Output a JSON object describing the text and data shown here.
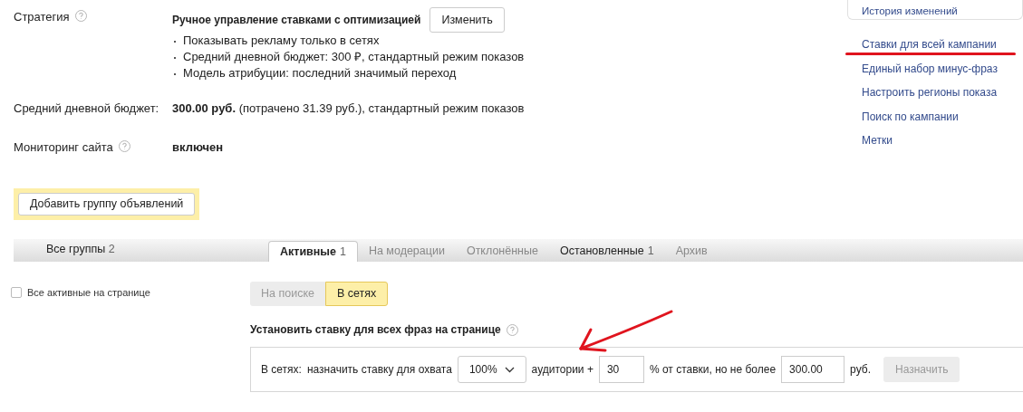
{
  "strategy": {
    "label": "Стратегия",
    "title": "Ручное управление ставками с оптимизацией",
    "change_button": "Изменить",
    "details": [
      "Показывать рекламу только в сетях",
      "Средний дневной бюджет: 300 ₽, стандартный режим показов",
      "Модель атрибуции: последний значимый переход"
    ]
  },
  "budget": {
    "label": "Средний дневной бюджет:",
    "value": "**300.00 руб.** (потрачено 31.39 руб.), стандартный режим показов"
  },
  "monitoring": {
    "label": "Мониторинг сайта",
    "value": "включен"
  },
  "side_card": {
    "link": "История изменений"
  },
  "side_links": [
    {
      "label": "Ставки для всей кампании",
      "underlined": true
    },
    {
      "label": "Единый набор минус-фраз",
      "underlined": false
    },
    {
      "label": "Настроить регионы показа",
      "underlined": false
    },
    {
      "label": "Поиск по кампании",
      "underlined": false
    },
    {
      "label": "Метки",
      "underlined": false
    }
  ],
  "add_group_button": "Добавить группу объявлений",
  "all_groups": {
    "label": "Все группы",
    "count": "2"
  },
  "tabs": [
    {
      "label": "Активные",
      "count": "1",
      "selected": true,
      "disabled": false
    },
    {
      "label": "На модерации",
      "selected": false,
      "disabled": true
    },
    {
      "label": "Отклонённые",
      "selected": false,
      "disabled": true
    },
    {
      "label": "Остановленные",
      "count": "1",
      "selected": false,
      "disabled": false
    },
    {
      "label": "Архив",
      "selected": false,
      "disabled": true
    }
  ],
  "select_all": {
    "label": "Все активные на странице",
    "checked": false
  },
  "placement_toggle": [
    {
      "label": "На поиске",
      "selected": false
    },
    {
      "label": "В сетях",
      "selected": true
    }
  ],
  "bid_heading": "Установить ставку для всех фраз на странице",
  "bid_form": {
    "prefix": "В сетях:",
    "text_1": "назначить ставку для охвата",
    "coverage": "100%",
    "text_2": "аудитории +",
    "percent": "30",
    "text_3": "% от ставки, но не более",
    "max": "300.00",
    "currency": "руб.",
    "submit": "Назначить",
    "submit_disabled": true
  }
}
